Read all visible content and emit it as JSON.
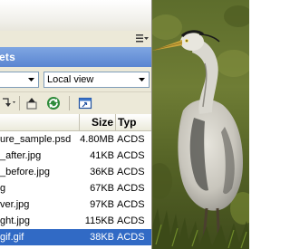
{
  "panel": {
    "title": "ets"
  },
  "controls": {
    "location_value": "",
    "view_value": "Local view"
  },
  "list": {
    "columns": {
      "size": "Size",
      "type": "Typ"
    },
    "rows": [
      {
        "name": "ure_sample.psd",
        "size": "4.80MB",
        "type": "ACDS",
        "selected": false
      },
      {
        "name": "_after.jpg",
        "size": "41KB",
        "type": "ACDS",
        "selected": false
      },
      {
        "name": "_before.jpg",
        "size": "36KB",
        "type": "ACDS",
        "selected": false
      },
      {
        "name": "g",
        "size": "67KB",
        "type": "ACDS",
        "selected": false
      },
      {
        "name": "ver.jpg",
        "size": "97KB",
        "type": "ACDS",
        "selected": false
      },
      {
        "name": "ght.jpg",
        "size": "115KB",
        "type": "ACDS",
        "selected": false
      },
      {
        "name": "gif.gif",
        "size": "38KB",
        "type": "ACDS",
        "selected": true
      }
    ]
  },
  "toolbar": {
    "icons": [
      "drop-arrow-icon",
      "up-folder-icon",
      "refresh-icon",
      "window-icon"
    ]
  },
  "colors": {
    "header_blue": "#5a85d1",
    "selection_blue": "#316ac5",
    "panel_bg": "#ece9d8"
  },
  "image": {
    "subject": "great-blue-heron-photo"
  }
}
